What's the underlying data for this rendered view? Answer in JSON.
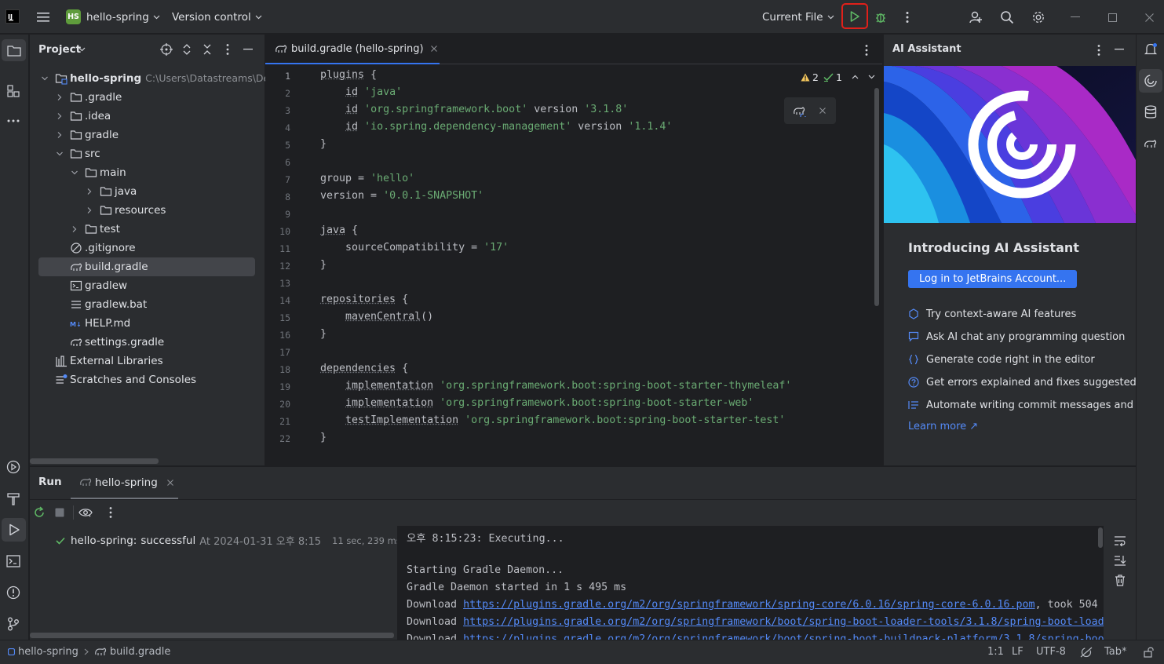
{
  "titlebar": {
    "project_badge": "HS",
    "project_name": "hello-spring",
    "vcs": "Version control",
    "run_config": "Current File"
  },
  "project_panel": {
    "title": "Project",
    "root_name": "hello-spring",
    "root_path": "C:\\Users\\Datastreams\\Des",
    "items": [
      {
        "label": ".gradle"
      },
      {
        "label": ".idea"
      },
      {
        "label": "gradle"
      },
      {
        "label": "src"
      },
      {
        "label": "main"
      },
      {
        "label": "java"
      },
      {
        "label": "resources"
      },
      {
        "label": "test"
      },
      {
        "label": ".gitignore"
      },
      {
        "label": "build.gradle"
      },
      {
        "label": "gradlew"
      },
      {
        "label": "gradlew.bat"
      },
      {
        "label": "HELP.md"
      },
      {
        "label": "settings.gradle"
      },
      {
        "label": "External Libraries"
      },
      {
        "label": "Scratches and Consoles"
      }
    ]
  },
  "editor": {
    "tab_label": "build.gradle (hello-spring)",
    "warnings": "2",
    "checks": "1",
    "line_numbers": [
      "1",
      "2",
      "3",
      "4",
      "5",
      "6",
      "7",
      "8",
      "9",
      "10",
      "11",
      "12",
      "13",
      "14",
      "15",
      "16",
      "17",
      "18",
      "19",
      "20",
      "21",
      "22"
    ],
    "code": {
      "l1_kw": "plugins",
      "l1_rest": " {",
      "l2_kw": "id",
      "l2_str": "'java'",
      "l3_kw": "id",
      "l3_str": "'org.springframework.boot'",
      "l3_mid": " version ",
      "l3_str2": "'3.1.8'",
      "l4_kw": "id",
      "l4_str": "'io.spring.dependency-management'",
      "l4_mid": " version ",
      "l4_str2": "'1.1.4'",
      "close": "}",
      "l7_a": "group = ",
      "l7_str": "'hello'",
      "l8_a": "version = ",
      "l8_str": "'0.0.1-SNAPSHOT'",
      "l10_kw": "java",
      "l10_rest": " {",
      "l11_a": "sourceCompatibility = ",
      "l11_str": "'17'",
      "l14_kw": "repositories",
      "l14_rest": " {",
      "l15_kw": "mavenCentral",
      "l15_rest": "()",
      "l18_kw": "dependencies",
      "l18_rest": " {",
      "l19_kw": "implementation",
      "l19_str": "'org.springframework.boot:spring-boot-starter-thymeleaf'",
      "l20_kw": "implementation",
      "l20_str": "'org.springframework.boot:spring-boot-starter-web'",
      "l21_kw": "testImplementation",
      "l21_str": "'org.springframework.boot:spring-boot-starter-test'"
    }
  },
  "ai_panel": {
    "title": "AI Assistant",
    "heading": "Introducing AI Assistant",
    "login_button": "Log in to JetBrains Account...",
    "features": [
      "Try context-aware AI features",
      "Ask AI chat any programming question",
      "Generate code right in the editor",
      "Get errors explained and fixes suggested",
      "Automate writing commit messages and dc"
    ],
    "learn_more": "Learn more ↗"
  },
  "run_panel": {
    "tab_run": "Run",
    "tab_config": "hello-spring",
    "result_name": "hello-spring:",
    "result_status": "successful",
    "result_time": "At 2024-01-31 오후 8:15",
    "result_duration": "11 sec, 239 ms",
    "console": {
      "l1": "오후 8:15:23: Executing...",
      "l2": "Starting Gradle Daemon...",
      "l3": "Gradle Daemon started in 1 s 495 ms",
      "d1_prefix": "Download ",
      "d1_link": "https://plugins.gradle.org/m2/org/springframework/spring-core/6.0.16/spring-core-6.0.16.pom",
      "d1_suffix": ", took 504 r",
      "d2_prefix": "Download ",
      "d2_link": "https://plugins.gradle.org/m2/org/springframework/boot/spring-boot-loader-tools/3.1.8/spring-boot-loade",
      "d3_prefix": "Download ",
      "d3_link": "https://plugins.gradle.org/m2/org/springframework/boot/spring-boot-buildpack-platform/3.1.8/spring-boot"
    }
  },
  "statusbar": {
    "crumb1": "hello-spring",
    "crumb2": "build.gradle",
    "position": "1:1",
    "line_sep": "LF",
    "encoding": "UTF-8",
    "indent": "Tab*"
  },
  "colors": {
    "accent": "#3574f0",
    "run_green": "#5fb865",
    "highlight_red": "#e0201a"
  }
}
